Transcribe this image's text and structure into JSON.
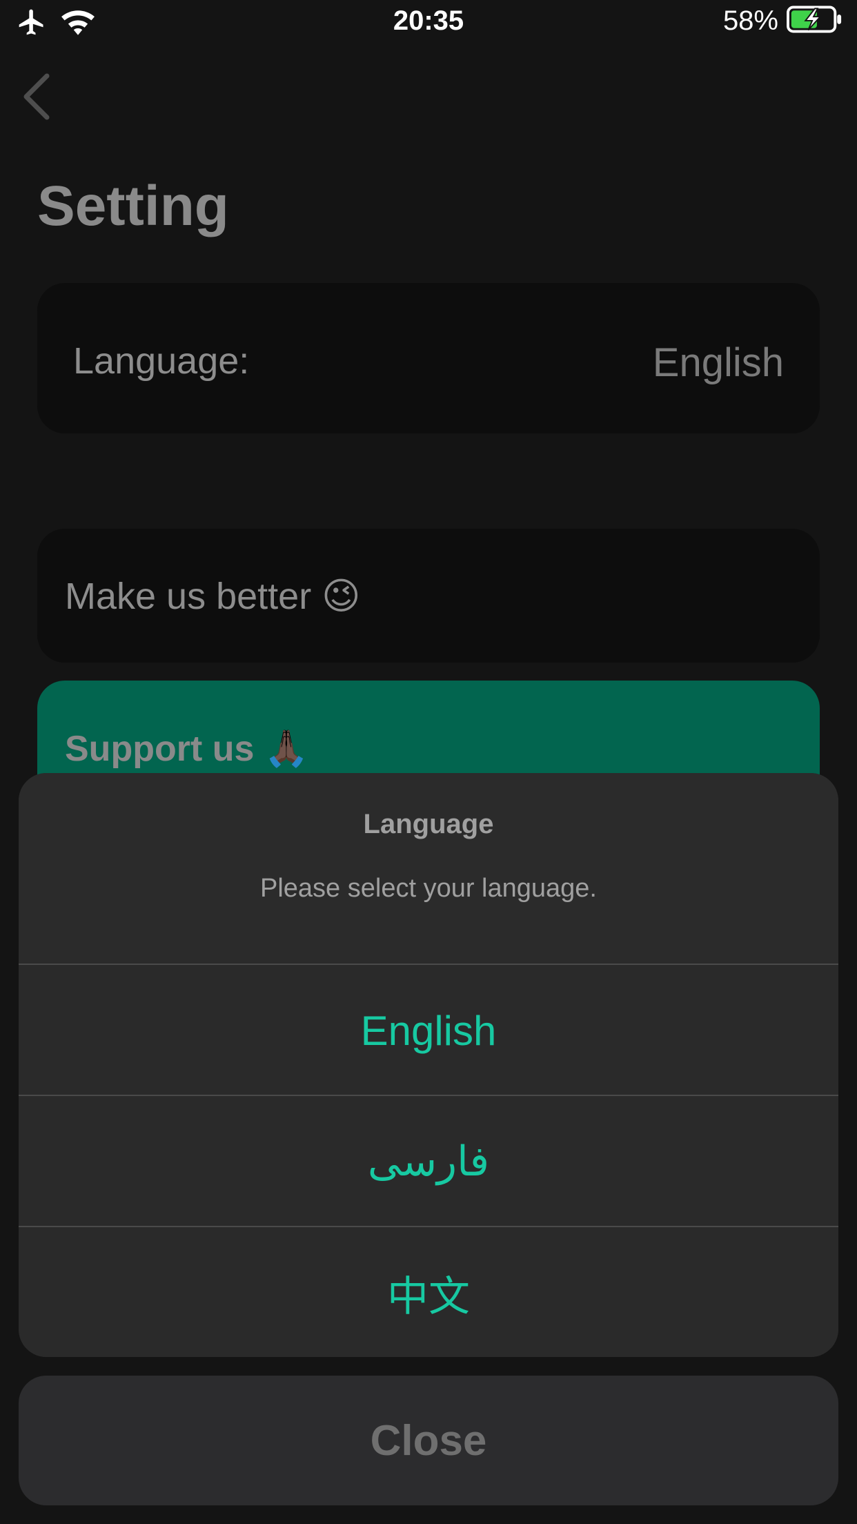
{
  "status_bar": {
    "time": "20:35",
    "battery": "58%",
    "icons": [
      "airplane-icon",
      "wifi-icon",
      "battery-charging-icon"
    ]
  },
  "page": {
    "title": "Setting",
    "language_label": "Language:",
    "language_value": "English",
    "make_better": "Make us better 😉",
    "support": "Support us 🙏🏿"
  },
  "sheet": {
    "title": "Language",
    "message": "Please select your language.",
    "options": [
      "English",
      "فارسی",
      "中文"
    ],
    "close": "Close"
  },
  "colors": {
    "accent": "#17c9a2",
    "support_bg": "#02654f",
    "sheet_bg": "#2a2a2a"
  }
}
